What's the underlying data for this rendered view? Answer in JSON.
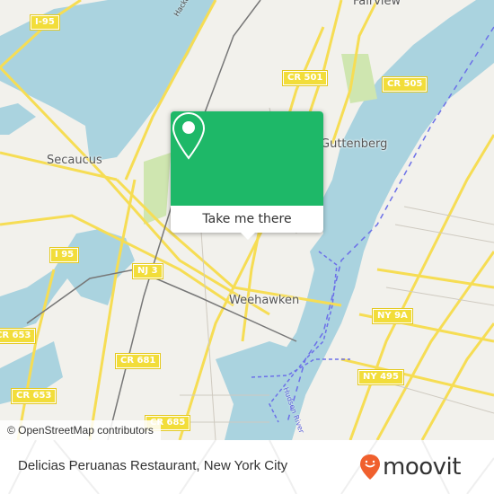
{
  "map": {
    "place_labels": [
      {
        "id": "fairview",
        "text": "Fairview"
      },
      {
        "id": "secaucus",
        "text": "Secaucus"
      },
      {
        "id": "guttenberg",
        "text": "Guttenberg"
      },
      {
        "id": "weehawken",
        "text": "Weehawken"
      }
    ],
    "river_labels": [
      {
        "id": "hackensack",
        "text": "Hackensack River"
      },
      {
        "id": "hudson",
        "text": "Hudson River"
      }
    ],
    "road_shields": [
      {
        "id": "i-95-top",
        "text": "I-95"
      },
      {
        "id": "cr-501",
        "text": "CR 501"
      },
      {
        "id": "cr-505",
        "text": "CR 505"
      },
      {
        "id": "i-95",
        "text": "I 95"
      },
      {
        "id": "nj-3",
        "text": "NJ 3"
      },
      {
        "id": "cr-653-a",
        "text": "CR 653"
      },
      {
        "id": "cr-681",
        "text": "CR 681"
      },
      {
        "id": "cr-653-b",
        "text": "CR 653"
      },
      {
        "id": "cr-685",
        "text": "CR 685"
      },
      {
        "id": "ny-9a",
        "text": "NY 9A"
      },
      {
        "id": "ny-495",
        "text": "NY 495"
      }
    ],
    "attribution": "© OpenStreetMap contributors",
    "colors": {
      "water": "#aad3df",
      "land": "#f2f1ec",
      "road": "#f6dd54",
      "park": "#cfe6b0",
      "ferry": "#6c70e8"
    }
  },
  "popup": {
    "icon": "location-pin-icon",
    "action_label": "Take me there",
    "color": "#1eb868"
  },
  "footer": {
    "place_title": "Delicias Peruanas Restaurant, New York City",
    "brand": "moovit",
    "brand_color": "#f0602e"
  }
}
